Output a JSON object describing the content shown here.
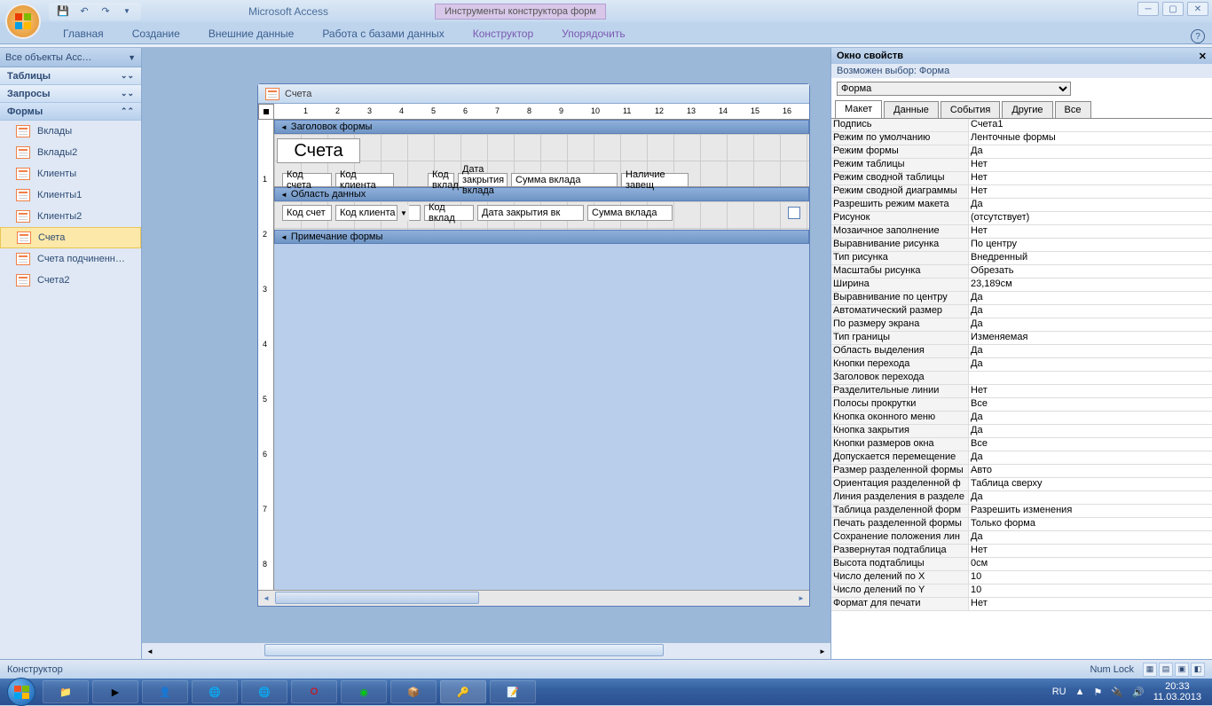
{
  "titlebar": {
    "app": "Microsoft Access",
    "context_tools": "Инструменты конструктора форм"
  },
  "ribbon": {
    "tabs": [
      "Главная",
      "Создание",
      "Внешние данные",
      "Работа с базами данных"
    ],
    "ctx_tabs": [
      "Конструктор",
      "Упорядочить"
    ]
  },
  "nav": {
    "header": "Все объекты Acc…",
    "groups": {
      "tables": "Таблицы",
      "queries": "Запросы",
      "forms": "Формы"
    },
    "forms": [
      "Вклады",
      "Вклады2",
      "Клиенты",
      "Клиенты1",
      "Клиенты2",
      "Счета",
      "Счета подчиненн…",
      "Счета2"
    ],
    "selected": "Счета"
  },
  "designer": {
    "title": "Счета",
    "sections": {
      "header": "Заголовок формы",
      "detail": "Область данных",
      "footer": "Примечание формы"
    },
    "form_title": "Счета",
    "header_labels": [
      "Код счета",
      "Код клиента",
      "Код вклада",
      "Дата закрытия вклада",
      "Сумма вклада",
      "Наличие завещ"
    ],
    "detail_fields": [
      "Код счет",
      "Код клиента",
      "Код вклад",
      "Дата закрытия вк",
      "Сумма вклада"
    ]
  },
  "propsheet": {
    "title": "Окно свойств",
    "subtitle": "Возможен выбор:  Форма",
    "selector": "Форма",
    "tabs": [
      "Макет",
      "Данные",
      "События",
      "Другие",
      "Все"
    ],
    "rows": [
      [
        "Подпись",
        "Счета1"
      ],
      [
        "Режим по умолчанию",
        "Ленточные формы"
      ],
      [
        "Режим формы",
        "Да"
      ],
      [
        "Режим таблицы",
        "Нет"
      ],
      [
        "Режим сводной таблицы",
        "Нет"
      ],
      [
        "Режим сводной диаграммы",
        "Нет"
      ],
      [
        "Разрешить режим макета",
        "Да"
      ],
      [
        "Рисунок",
        "(отсутствует)"
      ],
      [
        "Мозаичное заполнение",
        "Нет"
      ],
      [
        "Выравнивание рисунка",
        "По центру"
      ],
      [
        "Тип рисунка",
        "Внедренный"
      ],
      [
        "Масштабы рисунка",
        "Обрезать"
      ],
      [
        "Ширина",
        "23,189см"
      ],
      [
        "Выравнивание по центру",
        "Да"
      ],
      [
        "Автоматический размер",
        "Да"
      ],
      [
        "По размеру экрана",
        "Да"
      ],
      [
        "Тип границы",
        "Изменяемая"
      ],
      [
        "Область выделения",
        "Да"
      ],
      [
        "Кнопки перехода",
        "Да"
      ],
      [
        "Заголовок перехода",
        ""
      ],
      [
        "Разделительные линии",
        "Нет"
      ],
      [
        "Полосы прокрутки",
        "Все"
      ],
      [
        "Кнопка оконного меню",
        "Да"
      ],
      [
        "Кнопка закрытия",
        "Да"
      ],
      [
        "Кнопки размеров окна",
        "Все"
      ],
      [
        "Допускается перемещение",
        "Да"
      ],
      [
        "Размер разделенной формы",
        "Авто"
      ],
      [
        "Ориентация разделенной ф",
        "Таблица сверху"
      ],
      [
        "Линия разделения в разделе",
        "Да"
      ],
      [
        "Таблица разделенной форм",
        "Разрешить изменения"
      ],
      [
        "Печать разделенной формы",
        "Только форма"
      ],
      [
        "Сохранение положения лин",
        "Да"
      ],
      [
        "Развернутая подтаблица",
        "Нет"
      ],
      [
        "Высота подтаблицы",
        "0см"
      ],
      [
        "Число делений по X",
        "10"
      ],
      [
        "Число делений по Y",
        "10"
      ],
      [
        "Формат для печати",
        "Нет"
      ]
    ]
  },
  "statusbar": {
    "left": "Конструктор",
    "numlock": "Num Lock"
  },
  "tray": {
    "lang": "RU",
    "time": "20:33",
    "date": "11.03.2013"
  }
}
